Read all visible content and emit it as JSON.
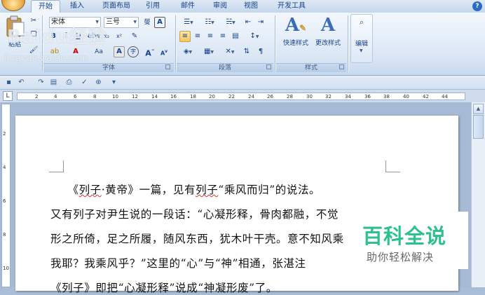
{
  "tabs": [
    "开始",
    "插入",
    "页面布局",
    "引用",
    "邮件",
    "审阅",
    "视图",
    "开发工具"
  ],
  "help_icon": "?",
  "clipboard": {
    "paste_label": "粘贴"
  },
  "font": {
    "name": "宋体",
    "size": "三号",
    "color_letter": "A",
    "aa_label": "Aa",
    "phonetic_char": "燮",
    "border_char": "A",
    "enlarge_char": "A",
    "shrink_char": "A",
    "circle_char": "字"
  },
  "groups": {
    "font_label": "字体",
    "paragraph_label": "段落",
    "styles_label": "样式"
  },
  "styles": {
    "quick_styles_label": "快速样式",
    "change_styles_label": "更改样式"
  },
  "editing": {
    "label": "编辑",
    "icon_text": "🔭"
  },
  "watermark": {
    "logo_text": "Baidu经验",
    "url_text": "jingyan.baidu.com"
  },
  "ruler": {
    "tab_icon": "L",
    "marks": [
      "2",
      "4",
      "6",
      "8",
      "10",
      "12",
      "14",
      "16",
      "18",
      "20",
      "22",
      "24",
      "26",
      "28",
      "30",
      "32",
      "34",
      "36",
      "38",
      "40",
      "42",
      "44"
    ]
  },
  "vruler_marks": [
    "2",
    "4",
    "6",
    "8",
    "10"
  ],
  "document": {
    "lines": [
      "　　《列子·黄帝》一篇，见有列子“乘风而归”的说法。",
      "又有列子对尹生说的一段话：“心凝形释，骨肉都融，不觉",
      "形之所倚，足之所履，随风东西，犹木叶干壳。意不知风乘",
      "我耶？我乘风乎？”这里的“心”与“神”相通，张湛注",
      "《列子》即把“心凝形释”说成“神凝形废”了。"
    ]
  },
  "badge": {
    "title": "百科全说",
    "subtitle": "助你轻松解决"
  },
  "colors": {
    "accent_green": "#2ec08f",
    "ribbon_blue": "#15428b",
    "highlight": "#f9c55e"
  }
}
